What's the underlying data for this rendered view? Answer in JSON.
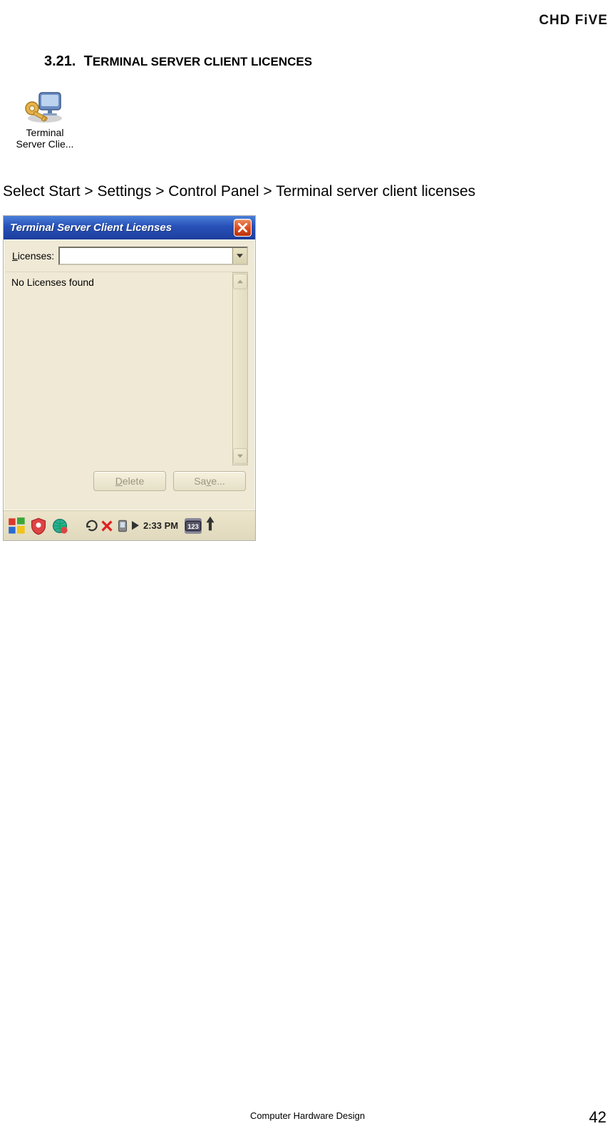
{
  "header": {
    "brand": "CHD FiVE"
  },
  "section": {
    "number": "3.21.",
    "title_first": "T",
    "title_rest": "ERMINAL SERVER CLIENT LICENCES"
  },
  "desktop_icon": {
    "line1": "Terminal",
    "line2": "Server Clie..."
  },
  "instruction": "Select Start > Settings > Control Panel > Terminal server client licenses",
  "dialog": {
    "title": "Terminal Server Client Licenses",
    "licenses_label_pre": "",
    "licenses_underline": "L",
    "licenses_label_post": "icenses:",
    "combo_value": "",
    "empty_message": "No Licenses found",
    "delete_pre": "",
    "delete_u": "D",
    "delete_post": "elete",
    "save_pre": "Sa",
    "save_u": "v",
    "save_post": "e..."
  },
  "taskbar": {
    "clock": "2:33 PM"
  },
  "footer": {
    "center": "Computer Hardware Design",
    "page": "42"
  }
}
